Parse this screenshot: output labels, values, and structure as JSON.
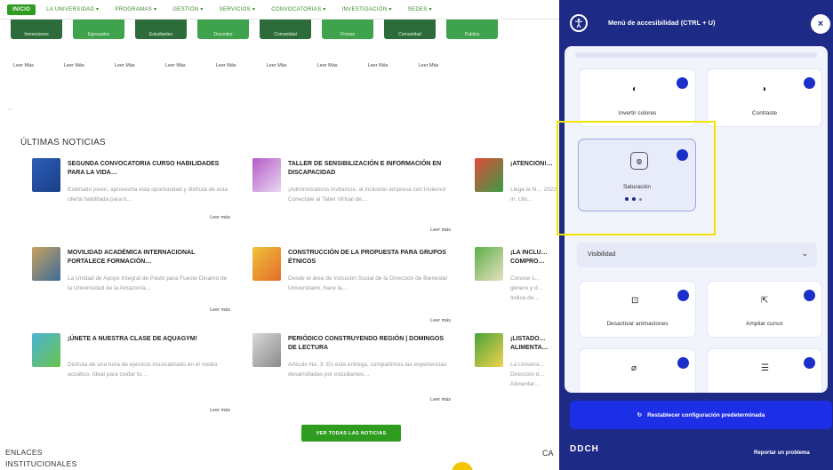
{
  "nav": {
    "items": [
      "INICIO",
      "LA UNIVERSIDAD ▾",
      "PROGRAMAS ▾",
      "GESTIÓN ▾",
      "SERVICIOS ▾",
      "CONVOCATORIAS ▾",
      "INVESTIGACIÓN ▾",
      "SEDES ▾"
    ]
  },
  "thumbnails": [
    "Inmersiones",
    "Egresados",
    "Estudiantes",
    "Docentes",
    "Comunidad",
    "Prensa",
    "Comunidad",
    "Publica"
  ],
  "leer_mas_row": [
    "Leer Más",
    "Leer Más",
    "Leer Más",
    "Leer Más",
    "Leer Más",
    "Leer Más",
    "Leer Más",
    "Leer Más",
    "Leer Más"
  ],
  "news": {
    "section_title": "ÚLTIMAS NOTICIAS",
    "items": [
      {
        "title": "SEGUNDA CONVOCATORIA CURSO HABILIDADES PARA LA VIDA…",
        "excerpt": "Estimado joven, aprovecha esta oportunidad y disfruta de esta oferta habilitada para ti…",
        "more": "Leer más"
      },
      {
        "title": "TALLER DE SENSIBILIZACIÓN E INFORMACIÓN EN DISCAPACIDAD",
        "excerpt": "¡Administrativos Invitamos, al inclusión empresa con Invierno! Conectate al Taller Virtual de…",
        "more": "Leer más"
      },
      {
        "title": "¡ATENCIÓN!…",
        "excerpt": "Llega la N… 2022, m. Ubi…",
        "more": ""
      },
      {
        "title": "MOVILIDAD ACADÉMICA INTERNACIONAL FORTALECE FORMACIÓN…",
        "excerpt": "La Unidad de Apoyo Integral de Pasto para Fueste Dinamo de la Universidad de la Amazonía…",
        "more": "Leer más"
      },
      {
        "title": "CONSTRUCCIÓN DE LA PROPUESTA PARA GRUPOS ÉTNICOS",
        "excerpt": "Desde el área de Inclusión Social de la Dirección de Bienestar Universitario, hace la…",
        "more": "Leer más"
      },
      {
        "title": "¡LA INCLU… COMPRO…",
        "excerpt": "Conoce s… género y d… Indica de…",
        "more": ""
      },
      {
        "title": "¡ÚNETE A NUESTRA CLASE DE AQUAGYM!",
        "excerpt": "Disfruta de una hora de ejercicio musicalizado en el medio acuático. Ideal para cuidar tu…",
        "more": "Leer más"
      },
      {
        "title": "PERIÓDICO CONSTRUYENDO REGIÓN | DOMINGOS DE LECTURA",
        "excerpt": "Artículo No. 3. En esta entrega, compartimos las experiencias desarrolladas por estudiantes…",
        "more": "Leer más"
      },
      {
        "title": "¡LISTADO… ALIMENTA…",
        "excerpt": "La Universi… Dirección d… Alimentar…",
        "more": ""
      }
    ],
    "view_all": "VER TODAS LAS NOTICIAS"
  },
  "footer_site": {
    "enlaces_line1": "ENLACES",
    "enlaces_line2": "INSTITUCIONALES",
    "cap_c": "CA"
  },
  "accessibility": {
    "title": "Menú de accesibilidad (CTRL + U)",
    "close": "×",
    "cards": {
      "invert_colors": "Invertir colores",
      "contrast": "Contraste",
      "saturation": "Saturación"
    },
    "dropdown_label": "Visibilidad",
    "cards2": {
      "disable_animations": "Desactivar animaciones",
      "enlarge_cursor": "Ampliar cursor"
    },
    "reset_label": "Restablecer configuración predeterminada",
    "logo_text": "DDCH",
    "report_link": "Reportar un problema"
  },
  "colors": {
    "panel_bg": "#1d2a86",
    "accent_blue": "#1d2fe6",
    "site_green": "#2e9c1f",
    "highlight_yellow": "#f2e400"
  }
}
